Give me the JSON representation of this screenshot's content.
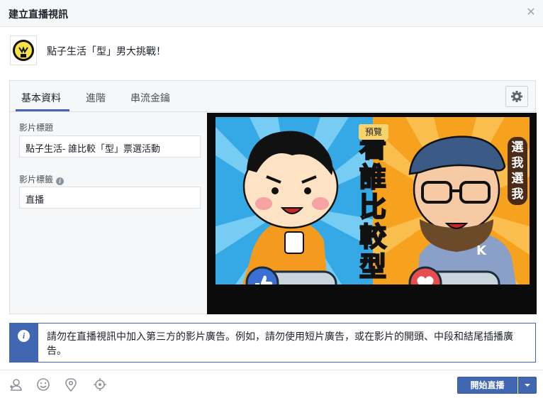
{
  "dialog": {
    "title": "建立直播視訊"
  },
  "page": {
    "name": "點子生活「型」男大挑戰！"
  },
  "tabs": [
    {
      "label": "基本資料",
      "active": true
    },
    {
      "label": "進階",
      "active": false
    },
    {
      "label": "串流金鑰",
      "active": false
    }
  ],
  "form": {
    "title_label": "影片標題",
    "title_value": "點子生活- 誰比較「型」票選活動",
    "tags_label": "影片標籤",
    "tags_value": "直播"
  },
  "preview": {
    "badge": "預覽",
    "vertical_text": "看誰比較型",
    "right_text": "選我選我",
    "logo_letter": "K"
  },
  "notice": {
    "text": "請勿在直播視訊中加入第三方的影片廣告。例如，請勿使用短片廣告，或在影片的開頭、中段和結尾插播廣告。"
  },
  "footer": {
    "go_live_label": "開始直播",
    "icons": [
      "tag-people-icon",
      "feeling-icon",
      "location-icon",
      "target-audience-icon"
    ]
  },
  "colors": {
    "brand": "#4267b2",
    "left_bg": "#35a8e6",
    "right_bg": "#f6a21e"
  }
}
